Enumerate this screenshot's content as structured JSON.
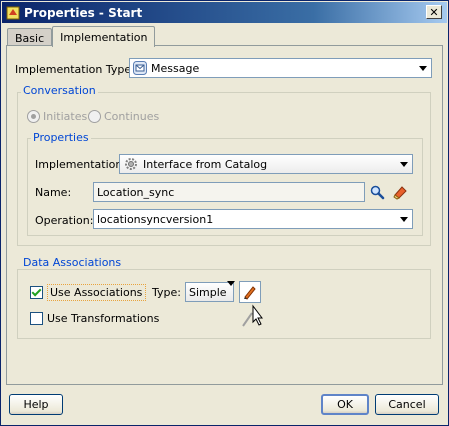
{
  "window": {
    "title": "Properties - Start"
  },
  "tabs": [
    {
      "label": "Basic",
      "active": false
    },
    {
      "label": "Implementation",
      "active": true
    }
  ],
  "implementation_type": {
    "label": "Implementation Type:",
    "value": "Message"
  },
  "conversation": {
    "title": "Conversation",
    "options": [
      "Initiates",
      "Continues"
    ],
    "selected": "Initiates"
  },
  "properties": {
    "title": "Properties",
    "implementation": {
      "label": "Implementation:",
      "value": "Interface from Catalog"
    },
    "name": {
      "label": "Name:",
      "value": "Location_sync"
    },
    "operation": {
      "label": "Operation:",
      "value": "locationsyncversion1"
    }
  },
  "data_associations": {
    "title": "Data Associations",
    "use_associations": {
      "label": "Use Associations",
      "checked": true
    },
    "type": {
      "label": "Type:",
      "value": "Simple"
    },
    "use_transformations": {
      "label": "Use Transformations",
      "checked": false
    }
  },
  "buttons": {
    "help": "Help",
    "ok": "OK",
    "cancel": "Cancel"
  },
  "icons": [
    "app-icon",
    "close-icon",
    "message-icon",
    "catalog-gear-icon",
    "search-icon",
    "eraser-icon",
    "edit-pencil-icon",
    "mouse-cursor-icon"
  ]
}
